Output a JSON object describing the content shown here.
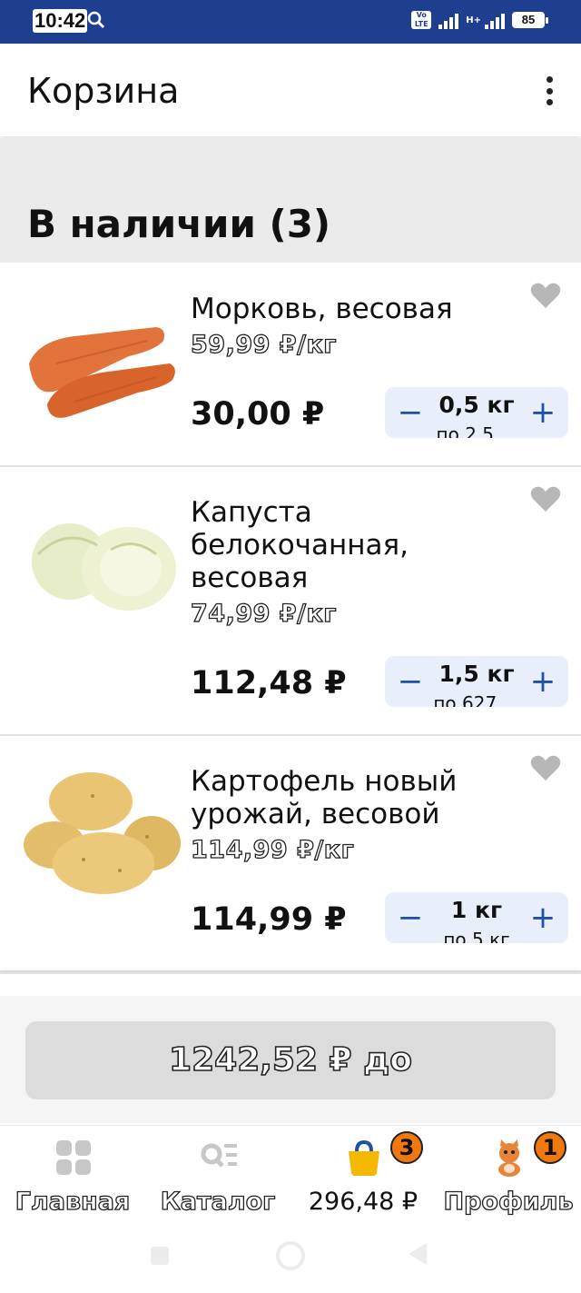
{
  "status_bar": {
    "time": "10:42",
    "network_badge": "Vo LTE",
    "data_type": "H+",
    "battery": "85"
  },
  "app_bar": {
    "title": "Корзина",
    "menu_icon": "more-vertical-icon"
  },
  "section": {
    "title": "В наличии (3)"
  },
  "items": [
    {
      "name": "Морковь, весовая",
      "unit_price": "59,99 ₽/кг",
      "price": "30,00 ₽",
      "quantity": "0,5 кг",
      "quantity_sub": "по 2,5 ..."
    },
    {
      "name": "Капуста белокочанная, весовая",
      "unit_price": "74,99 ₽/кг",
      "price": "112,48 ₽",
      "quantity": "1,5 кг",
      "quantity_sub": "по 627 ..."
    },
    {
      "name": "Картофель новый урожай, весовой",
      "unit_price": "114,99 ₽/кг",
      "price": "114,99 ₽",
      "quantity": "1 кг",
      "quantity_sub": "по 5 кг"
    }
  ],
  "stepper": {
    "minus": "−",
    "plus": "+"
  },
  "checkout": {
    "label": "1242,52 ₽ до"
  },
  "bottom_nav": {
    "home": "Главная",
    "catalog": "Каталог",
    "cart_total": "296,48 ₽",
    "cart_badge": "3",
    "profile": "Профиль",
    "profile_badge": "1"
  },
  "colors": {
    "status_bar": "#1e3f8f",
    "accent": "#1f4fa8",
    "badge": "#f0780e",
    "cart_icon": "#f5b800"
  }
}
